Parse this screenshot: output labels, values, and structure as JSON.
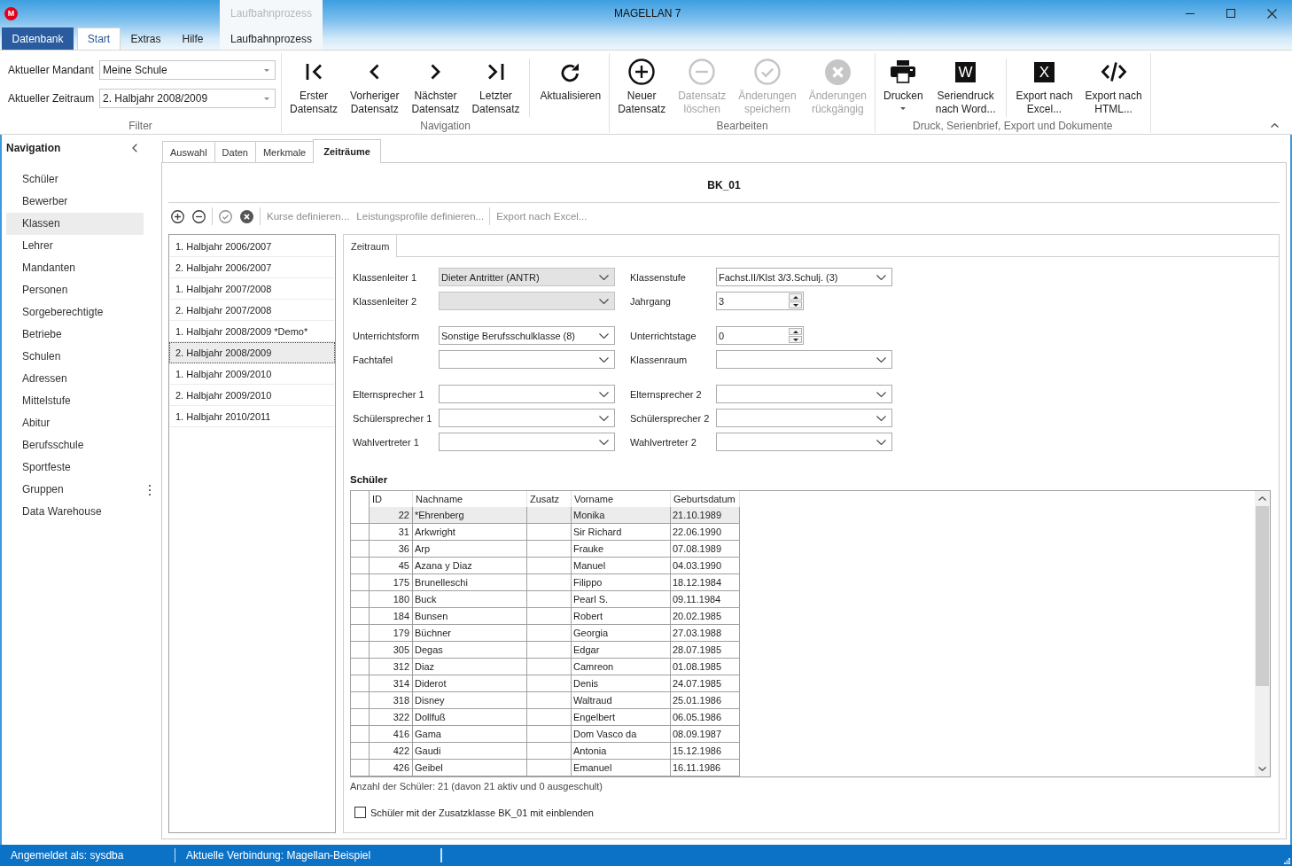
{
  "window": {
    "logo": "M",
    "title": "MAGELLAN 7"
  },
  "ribbon_tabs": [
    {
      "label": "Datenbank",
      "kind": "menu",
      "selected": false
    },
    {
      "label": "Start",
      "kind": "tab",
      "selected": true
    },
    {
      "label": "Extras",
      "kind": "tab",
      "selected": false
    },
    {
      "label": "Hilfe",
      "kind": "tab",
      "selected": false
    }
  ],
  "context_tab_group": {
    "header": "Laufbahnprozess",
    "tabs": [
      {
        "label": "Laufbahnprozess",
        "selected": false
      }
    ]
  },
  "ribbon_groups": [
    {
      "label": "Filter",
      "kind": "fields",
      "fields": [
        {
          "label": "Aktueller Mandant",
          "value": "Meine Schule"
        },
        {
          "label": "Aktueller Zeitraum",
          "value": "2. Halbjahr 2008/2009"
        }
      ]
    },
    {
      "label": "Navigation",
      "kind": "buttons",
      "sections": [
        [
          {
            "lines": [
              "Erster",
              "Datensatz"
            ],
            "disabled": false,
            "dropdown": false
          },
          {
            "lines": [
              "Vorheriger",
              "Datensatz"
            ],
            "disabled": false,
            "dropdown": false
          },
          {
            "lines": [
              "Nächster",
              "Datensatz"
            ],
            "disabled": false,
            "dropdown": false
          },
          {
            "lines": [
              "Letzter",
              "Datensatz"
            ],
            "disabled": false,
            "dropdown": false
          }
        ],
        [
          {
            "lines": [
              "Aktualisieren"
            ],
            "disabled": false,
            "dropdown": false
          }
        ]
      ]
    },
    {
      "label": "Bearbeiten",
      "kind": "buttons",
      "sections": [
        [
          {
            "lines": [
              "Neuer",
              "Datensatz"
            ],
            "disabled": false,
            "dropdown": false
          },
          {
            "lines": [
              "Datensatz",
              "löschen"
            ],
            "disabled": true,
            "dropdown": false
          },
          {
            "lines": [
              "Änderungen",
              "speichern"
            ],
            "disabled": true,
            "dropdown": false
          },
          {
            "lines": [
              "Änderungen",
              "rückgängig"
            ],
            "disabled": true,
            "dropdown": false
          }
        ]
      ]
    },
    {
      "label": "Druck, Serienbrief, Export und Dokumente",
      "kind": "buttons",
      "sections": [
        [
          {
            "lines": [
              "Drucken"
            ],
            "disabled": false,
            "dropdown": true
          },
          {
            "lines": [
              "Seriendruck",
              "nach Word..."
            ],
            "icon_text": "W",
            "disabled": false,
            "dropdown": false
          }
        ],
        [
          {
            "lines": [
              "Export nach",
              "Excel..."
            ],
            "icon_text": "X",
            "disabled": false,
            "dropdown": false
          },
          {
            "lines": [
              "Export nach",
              "HTML..."
            ],
            "disabled": false,
            "dropdown": false
          }
        ]
      ]
    }
  ],
  "navigation": {
    "title": "Navigation",
    "items": [
      {
        "label": "Schüler",
        "selected": false
      },
      {
        "label": "Bewerber",
        "selected": false
      },
      {
        "label": "Klassen",
        "selected": true
      },
      {
        "label": "Lehrer",
        "selected": false
      },
      {
        "label": "Mandanten",
        "selected": false
      },
      {
        "label": "Personen",
        "selected": false
      },
      {
        "label": "Sorgeberechtigte",
        "selected": false
      },
      {
        "label": "Betriebe",
        "selected": false
      },
      {
        "label": "Schulen",
        "selected": false
      },
      {
        "label": "Adressen",
        "selected": false
      },
      {
        "label": "Mittelstufe",
        "selected": false
      },
      {
        "label": "Abitur",
        "selected": false
      },
      {
        "label": "Berufsschule",
        "selected": false
      },
      {
        "label": "Sportfeste",
        "selected": false
      },
      {
        "label": "Gruppen",
        "selected": false
      },
      {
        "label": "Data Warehouse",
        "selected": false
      }
    ]
  },
  "record_tabs": [
    {
      "label": "Auswahl",
      "selected": false
    },
    {
      "label": "Daten",
      "selected": false
    },
    {
      "label": "Merkmale",
      "selected": false
    },
    {
      "label": "Zeiträume",
      "selected": true
    }
  ],
  "record": {
    "title": "BK_01",
    "toolbar": [
      [
        {
          "kind": "icon",
          "disabled": false
        },
        {
          "kind": "icon",
          "disabled": false
        }
      ],
      [
        {
          "kind": "icon",
          "disabled": true
        },
        {
          "kind": "icon",
          "disabled": false
        }
      ],
      [
        {
          "kind": "text",
          "label": "Kurse definieren...",
          "disabled": true
        },
        {
          "kind": "text",
          "label": "Leistungsprofile definieren...",
          "disabled": true
        }
      ],
      [
        {
          "kind": "text",
          "label": "Export nach Excel...",
          "disabled": true
        }
      ]
    ],
    "periods": [
      {
        "label": "1. Halbjahr 2006/2007",
        "selected": false
      },
      {
        "label": "2. Halbjahr 2006/2007",
        "selected": false
      },
      {
        "label": "1. Halbjahr 2007/2008",
        "selected": false
      },
      {
        "label": "2. Halbjahr 2007/2008",
        "selected": false
      },
      {
        "label": "1. Halbjahr 2008/2009 *Demo*",
        "selected": false
      },
      {
        "label": "2. Halbjahr 2008/2009",
        "selected": true
      },
      {
        "label": "1. Halbjahr 2009/2010",
        "selected": false
      },
      {
        "label": "2. Halbjahr 2009/2010",
        "selected": false
      },
      {
        "label": "1. Halbjahr 2010/2011",
        "selected": false
      }
    ],
    "detail_tabs": [
      {
        "label": "Zeitraum",
        "selected": true
      }
    ],
    "form": [
      [
        [
          {
            "label": "Klassenleiter 1",
            "kind": "combo",
            "value": "Dieter Antritter (ANTR)",
            "disabled": true
          },
          {
            "label": "Klassenstufe",
            "kind": "combo",
            "value": "Fachst.II/Klst 3/3.Schulj. (3)",
            "disabled": false
          }
        ],
        [
          {
            "label": "Klassenleiter 2",
            "kind": "combo",
            "disabled": true
          },
          {
            "label": "Jahrgang",
            "kind": "spin",
            "value": "3",
            "disabled": false
          }
        ]
      ],
      [
        [
          {
            "label": "Unterrichtsform",
            "kind": "combo",
            "value": "Sonstige Berufsschulklasse (8)",
            "disabled": false
          },
          {
            "label": "Unterrichtstage",
            "kind": "spin",
            "value": "0",
            "disabled": false
          }
        ],
        [
          {
            "label": "Fachtafel",
            "kind": "combo",
            "disabled": false
          },
          {
            "label": "Klassenraum",
            "kind": "combo",
            "disabled": false
          }
        ]
      ],
      [
        [
          {
            "label": "Elternsprecher 1",
            "kind": "combo",
            "disabled": false
          },
          {
            "label": "Elternsprecher 2",
            "kind": "combo",
            "disabled": false
          }
        ],
        [
          {
            "label": "Schülersprecher 1",
            "kind": "combo",
            "disabled": false
          },
          {
            "label": "Schülersprecher 2",
            "kind": "combo",
            "disabled": false
          }
        ],
        [
          {
            "label": "Wahlvertreter 1",
            "kind": "combo",
            "disabled": false
          },
          {
            "label": "Wahlvertreter 2",
            "kind": "combo",
            "disabled": false
          }
        ]
      ]
    ],
    "students": {
      "title": "Schüler",
      "columns": [
        "ID",
        "Nachname",
        "Zusatz",
        "Vorname",
        "Geburtsdatum"
      ],
      "rows": [
        {
          "id": "22",
          "last_name": "*Ehrenberg",
          "first_name": "Monika",
          "birth_date": "21.10.1989",
          "selected": true
        },
        {
          "id": "31",
          "last_name": "Arkwright",
          "first_name": "Sir Richard",
          "birth_date": "22.06.1990",
          "selected": false
        },
        {
          "id": "36",
          "last_name": "Arp",
          "first_name": "Frauke",
          "birth_date": "07.08.1989",
          "selected": false
        },
        {
          "id": "45",
          "last_name": "Azana y Diaz",
          "first_name": "Manuel",
          "birth_date": "04.03.1990",
          "selected": false
        },
        {
          "id": "175",
          "last_name": "Brunelleschi",
          "first_name": "Filippo",
          "birth_date": "18.12.1984",
          "selected": false
        },
        {
          "id": "180",
          "last_name": "Buck",
          "first_name": "Pearl S.",
          "birth_date": "09.11.1984",
          "selected": false
        },
        {
          "id": "184",
          "last_name": "Bunsen",
          "first_name": "Robert",
          "birth_date": "20.02.1985",
          "selected": false
        },
        {
          "id": "179",
          "last_name": "Büchner",
          "first_name": "Georgia",
          "birth_date": "27.03.1988",
          "selected": false
        },
        {
          "id": "305",
          "last_name": "Degas",
          "first_name": "Edgar",
          "birth_date": "28.07.1985",
          "selected": false
        },
        {
          "id": "312",
          "last_name": "Diaz",
          "first_name": "Camreon",
          "birth_date": "01.08.1985",
          "selected": false
        },
        {
          "id": "314",
          "last_name": "Diderot",
          "first_name": "Denis",
          "birth_date": "24.07.1985",
          "selected": false
        },
        {
          "id": "318",
          "last_name": "Disney",
          "first_name": "Waltraud",
          "birth_date": "25.01.1986",
          "selected": false
        },
        {
          "id": "322",
          "last_name": "Dollfuß",
          "first_name": "Engelbert",
          "birth_date": "06.05.1986",
          "selected": false
        },
        {
          "id": "416",
          "last_name": "Gama",
          "first_name": "Dom Vasco da",
          "birth_date": "08.09.1987",
          "selected": false
        },
        {
          "id": "422",
          "last_name": "Gaudi",
          "first_name": "Antonia",
          "birth_date": "15.12.1986",
          "selected": false
        },
        {
          "id": "426",
          "last_name": "Geibel",
          "first_name": "Emanuel",
          "birth_date": "16.11.1986",
          "selected": false
        }
      ]
    },
    "student_count": "Anzahl der Schüler: 21 (davon 21 aktiv und 0 ausgeschult)",
    "show_additional_class": {
      "label": "Schüler mit der Zusatzklasse BK_01 mit einblenden",
      "checked": false
    }
  },
  "status_bar": [
    "Angemeldet als: sysdba",
    "Aktuelle Verbindung: Magellan-Beispiel"
  ]
}
